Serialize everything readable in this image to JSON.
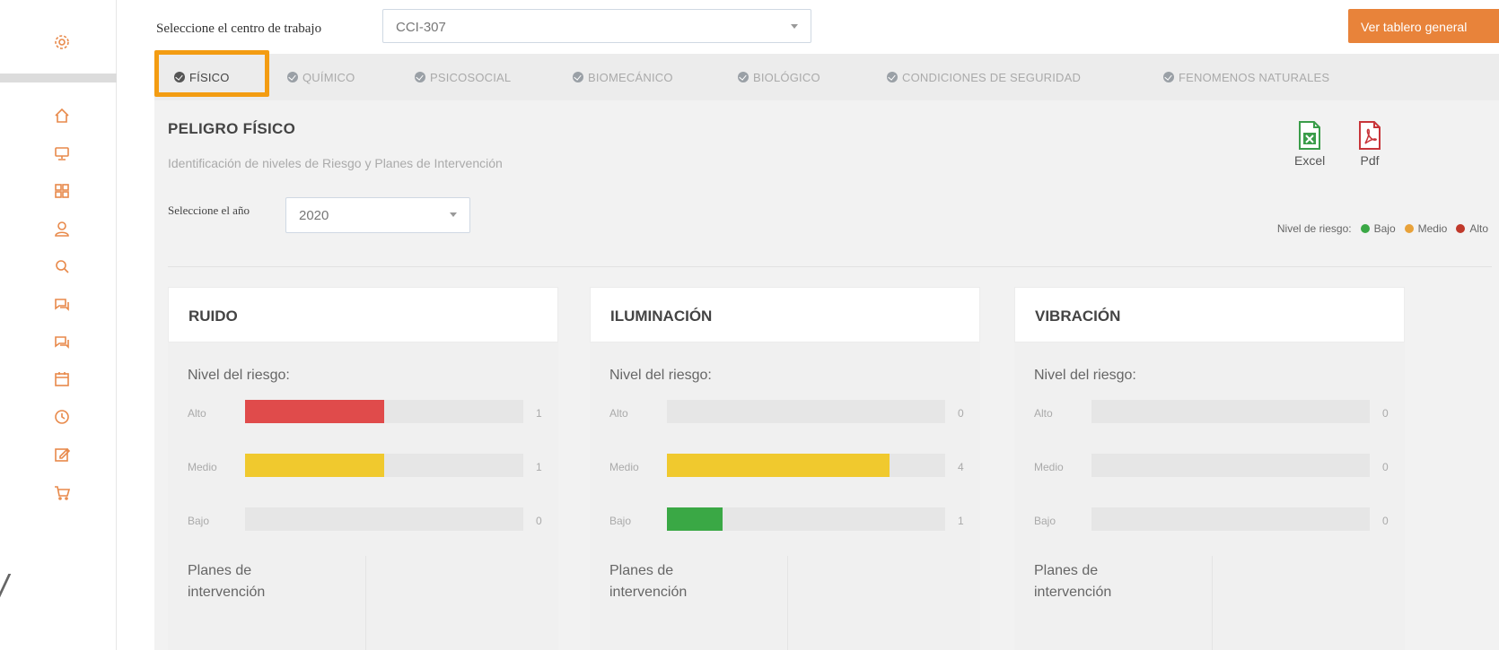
{
  "sidebar": {
    "icons": [
      "gear-icon",
      "home-icon",
      "monitor-icon",
      "grid-icon",
      "user-icon",
      "search-icon",
      "chat-icon",
      "chat-alt-icon",
      "calendar-icon",
      "clock-icon",
      "edit-icon",
      "cart-icon"
    ]
  },
  "topbar": {
    "workcenter_label": "Seleccione el centro de trabajo",
    "workcenter_value": "CCI-307",
    "general_button": "Ver tablero general"
  },
  "tabs": [
    {
      "label": "FÍSICO",
      "active": true
    },
    {
      "label": "QUÍMICO",
      "active": false
    },
    {
      "label": "PSICOSOCIAL",
      "active": false
    },
    {
      "label": "BIOMECÁNICO",
      "active": false
    },
    {
      "label": "BIOLÓGICO",
      "active": false
    },
    {
      "label": "CONDICIONES DE SEGURIDAD",
      "active": false
    },
    {
      "label": "FENOMENOS NATURALES",
      "active": false
    }
  ],
  "section": {
    "title": "PELIGRO FÍSICO",
    "subtitle": "Identificación de niveles de Riesgo y Planes de Intervención",
    "year_label": "Seleccione el año",
    "year_value": "2020",
    "excel_label": "Excel",
    "pdf_label": "Pdf"
  },
  "legend": {
    "title": "Nivel de riesgo:",
    "items": [
      {
        "label": "Bajo",
        "color": "#3aa845"
      },
      {
        "label": "Medio",
        "color": "#e8a23a"
      },
      {
        "label": "Alto",
        "color": "#c0392b"
      }
    ]
  },
  "card_common": {
    "risk_title": "Nivel del riesgo:",
    "plans_title": "Planes de intervención"
  },
  "cards": [
    {
      "title": "RUIDO",
      "rows": [
        {
          "label": "Alto",
          "count": "1",
          "fraction": 0.5,
          "color": "#e04b4b"
        },
        {
          "label": "Medio",
          "count": "1",
          "fraction": 0.5,
          "color": "#f0c92e"
        },
        {
          "label": "Bajo",
          "count": "0",
          "fraction": 0,
          "color": "#3aa845"
        }
      ]
    },
    {
      "title": "ILUMINACIÓN",
      "rows": [
        {
          "label": "Alto",
          "count": "0",
          "fraction": 0,
          "color": "#e04b4b"
        },
        {
          "label": "Medio",
          "count": "4",
          "fraction": 0.8,
          "color": "#f0c92e"
        },
        {
          "label": "Bajo",
          "count": "1",
          "fraction": 0.2,
          "color": "#3aa845"
        }
      ]
    },
    {
      "title": "VIBRACIÓN",
      "rows": [
        {
          "label": "Alto",
          "count": "0",
          "fraction": 0,
          "color": "#e04b4b"
        },
        {
          "label": "Medio",
          "count": "0",
          "fraction": 0,
          "color": "#f0c92e"
        },
        {
          "label": "Bajo",
          "count": "0",
          "fraction": 0,
          "color": "#3aa845"
        }
      ]
    }
  ]
}
